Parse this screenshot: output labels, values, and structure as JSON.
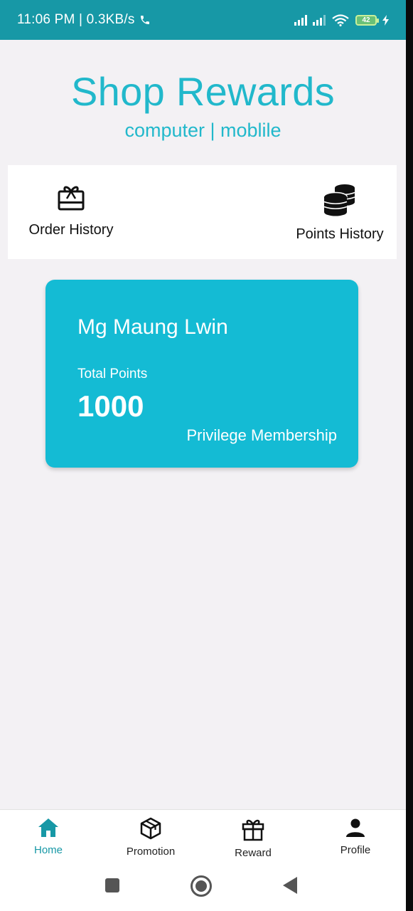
{
  "status_bar": {
    "time_speed": "11:06 PM | 0.3KB/s",
    "battery": "42"
  },
  "header": {
    "title": "Shop Rewards",
    "subtitle": "computer | moblile"
  },
  "quick_actions": {
    "order_history": "Order History",
    "points_history": "Points History"
  },
  "member_card": {
    "name": "Mg Maung Lwin",
    "points_label": "Total Points",
    "points": "1000",
    "tier": "Privilege Membership"
  },
  "bottom_nav": {
    "items": [
      {
        "label": "Home",
        "icon": "home-icon",
        "active": true
      },
      {
        "label": "Promotion",
        "icon": "box-icon",
        "active": false
      },
      {
        "label": "Reward",
        "icon": "gift-icon",
        "active": false
      },
      {
        "label": "Profile",
        "icon": "person-icon",
        "active": false
      }
    ]
  },
  "colors": {
    "accent": "#21b8cb",
    "status_bar": "#1798a6",
    "card": "#14bbd4",
    "background": "#f3f1f4"
  }
}
